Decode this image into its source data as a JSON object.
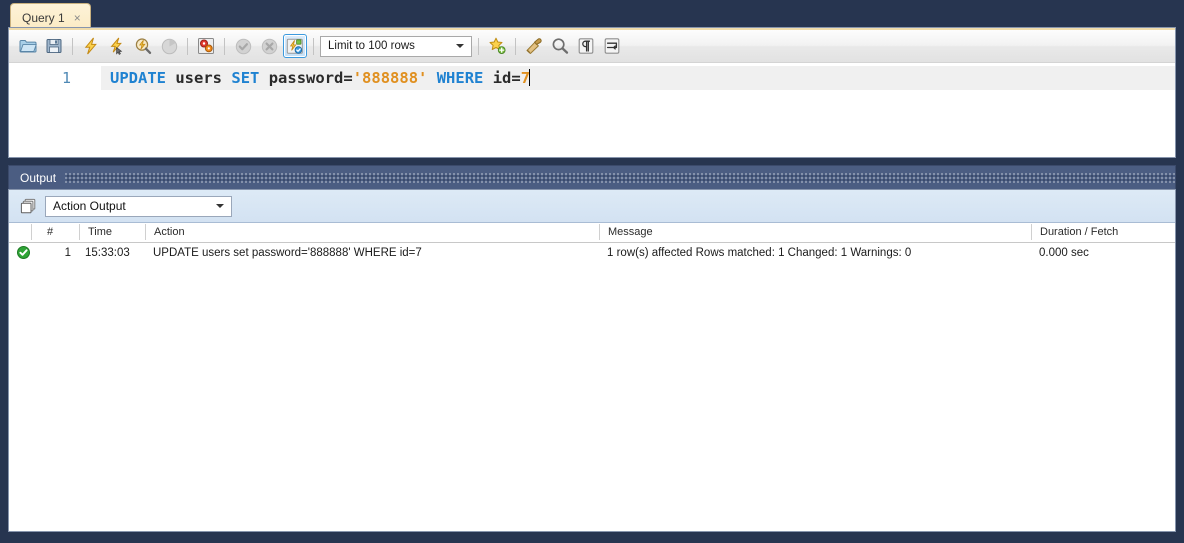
{
  "window": {
    "app": "MySQL Workbench SQL Editor"
  },
  "tab": {
    "label": "Query 1",
    "close_icon": "close-icon",
    "close_glyph": "×"
  },
  "toolbar": {
    "buttons": [
      {
        "name": "open-sql-script-button",
        "icon": "folder-icon",
        "title": "Open a script file in this editor",
        "state": "enabled"
      },
      {
        "name": "save-sql-script-button",
        "icon": "floppy-disk-icon",
        "title": "Save the script to a file",
        "state": "enabled"
      },
      {
        "name": "execute-statement-button",
        "icon": "lightning-bolt-icon",
        "title": "Execute the selected portion of the script or everything",
        "state": "enabled"
      },
      {
        "name": "execute-current-statement-button",
        "icon": "lightning-bolt-cursor-icon",
        "title": "Execute the statement under the keyboard cursor",
        "state": "enabled"
      },
      {
        "name": "explain-statement-button",
        "icon": "magnifier-lightning-icon",
        "title": "Execute the EXPLAIN command on the statement under the cursor",
        "state": "enabled"
      },
      {
        "name": "stop-execution-button",
        "icon": "stop-circle-icon",
        "title": "Stop the query being executed",
        "state": "disabled"
      },
      {
        "name": "toggle-query-stats-button",
        "icon": "gears-document-icon",
        "title": "Toggle whether execution of SQL script should continue after failed statements",
        "state": "enabled"
      },
      {
        "name": "commit-button",
        "icon": "check-circle-icon",
        "title": "Commit the current transaction",
        "state": "disabled"
      },
      {
        "name": "rollback-button",
        "icon": "cross-circle-icon",
        "title": "Rollback the current transaction",
        "state": "disabled"
      },
      {
        "name": "toggle-autocommit-button",
        "icon": "autocommit-icon",
        "title": "Toggle autocommit mode",
        "state": "active"
      }
    ],
    "limit_select": {
      "name": "row-limit-select",
      "value": "Limit to 100 rows"
    },
    "buttons_right": [
      {
        "name": "save-snippet-button",
        "icon": "star-plus-icon",
        "title": "Save current statement or selection to the snippet list",
        "state": "enabled"
      },
      {
        "name": "beautify-query-button",
        "icon": "brush-icon",
        "title": "Beautify/reformat the SQL script",
        "state": "enabled"
      },
      {
        "name": "find-button",
        "icon": "magnifier-icon",
        "title": "Show the Find panel for the editor",
        "state": "enabled"
      },
      {
        "name": "toggle-invisible-chars-button",
        "icon": "pilcrow-icon",
        "title": "Toggle display of invisible characters",
        "state": "enabled"
      },
      {
        "name": "toggle-word-wrap-button",
        "icon": "wrap-lines-icon",
        "title": "Toggle wrapping of long lines",
        "state": "enabled"
      }
    ]
  },
  "editor": {
    "line_number": "1",
    "statement_plain": "UPDATE users SET password='888888' WHERE id=7",
    "tokens": {
      "kw_update": "UPDATE",
      "sp1": " ",
      "id_users": "users",
      "sp2": " ",
      "kw_set": "SET",
      "sp3": " ",
      "id_password": "password",
      "eq1": "=",
      "str_value": "'888888'",
      "sp4": " ",
      "kw_where": "WHERE",
      "sp5": " ",
      "id_id": "id",
      "eq2": "=",
      "num_7": "7"
    },
    "colors": {
      "keyword": "#1f82d1",
      "identifier": "#2b2b2b",
      "string": "#e09020",
      "number": "#e09020",
      "line_number": "#4f89b5",
      "current_line_highlight": "#f0f0f0"
    }
  },
  "output": {
    "panel_title": "Output",
    "view_select": {
      "name": "output-view-select",
      "value": "Action Output"
    },
    "columns": [
      {
        "key": "num",
        "label": "#"
      },
      {
        "key": "time",
        "label": "Time"
      },
      {
        "key": "action",
        "label": "Action"
      },
      {
        "key": "message",
        "label": "Message"
      },
      {
        "key": "duration",
        "label": "Duration / Fetch"
      }
    ],
    "rows": [
      {
        "status": "success",
        "status_icon": "green-check-icon",
        "num": "1",
        "time": "15:33:03",
        "action": "UPDATE users set password='888888' WHERE id=7",
        "message": "1 row(s) affected Rows matched: 1  Changed: 1  Warnings: 0",
        "duration": "0.000 sec"
      }
    ]
  },
  "colors": {
    "window_background": "#273550",
    "tab_background": "#fdf2d8",
    "output_header": "#4b5d82",
    "output_toolbar": "#d6e4f3",
    "success_green": "#34a83a",
    "accent_blue": "#3c9ade"
  }
}
